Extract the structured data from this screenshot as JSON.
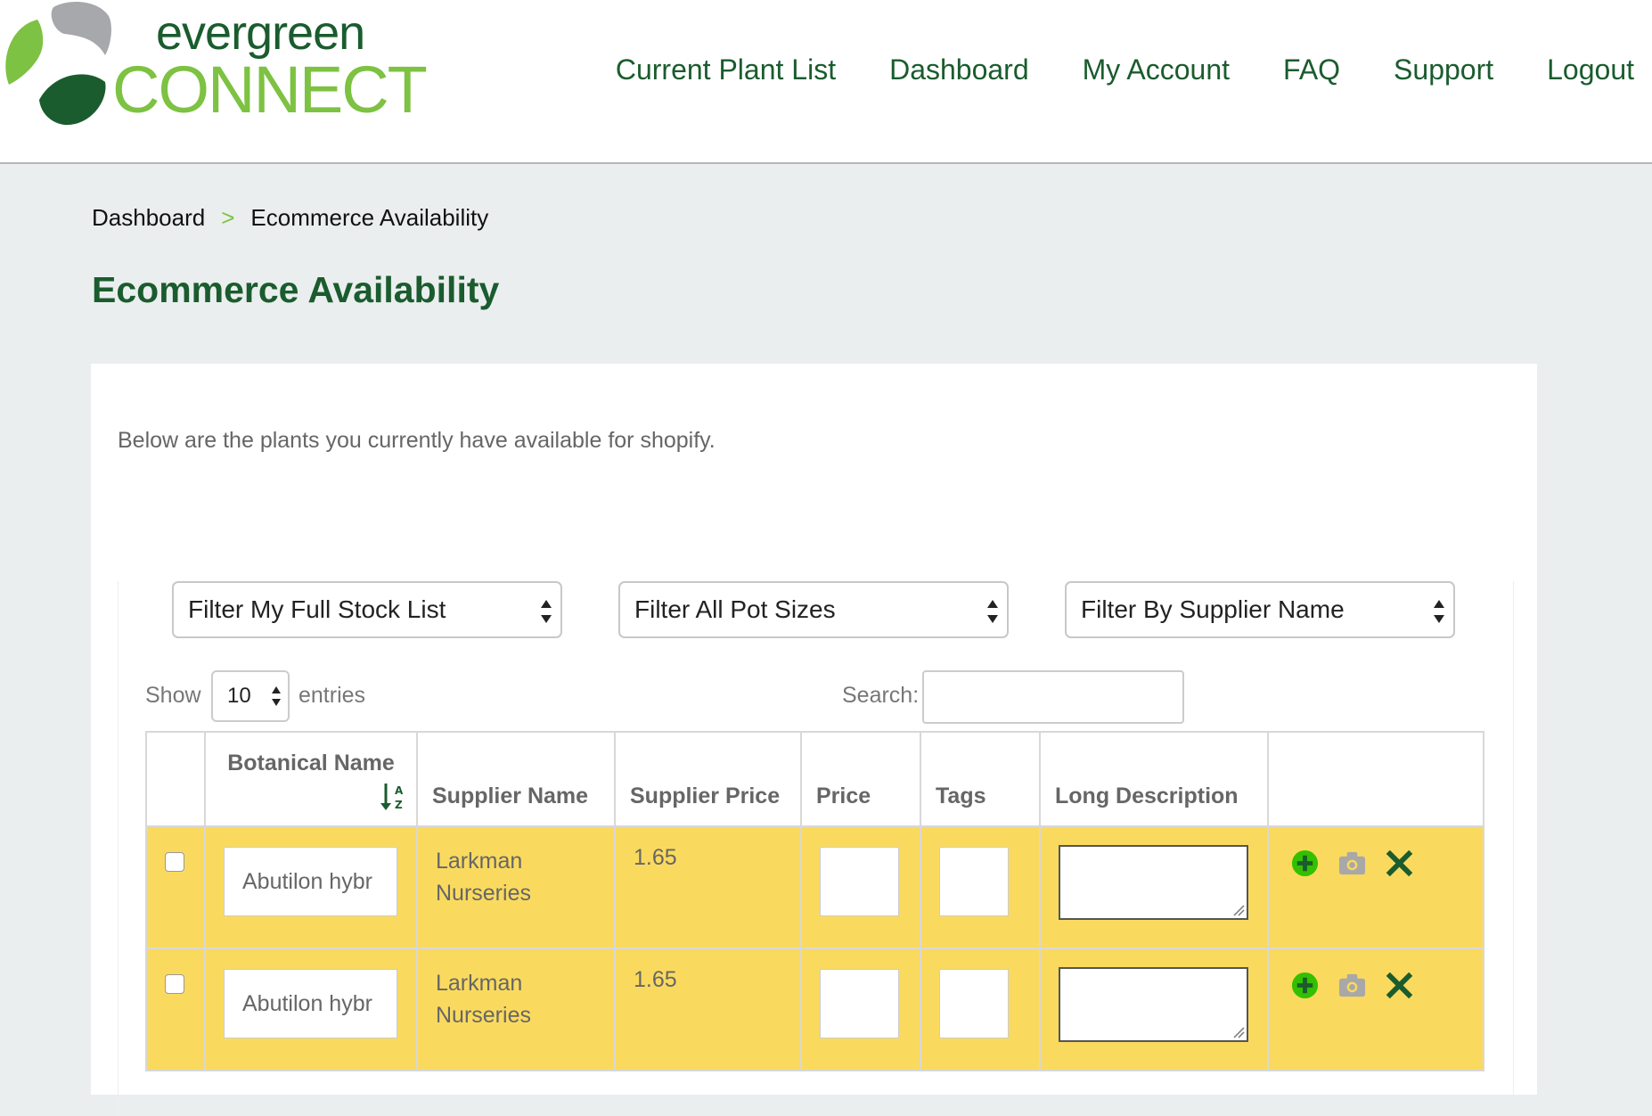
{
  "header": {
    "logo_text_top": "evergreen",
    "logo_text_bottom": "CONNECT",
    "nav": [
      "Current Plant List",
      "Dashboard",
      "My Account",
      "FAQ",
      "Support",
      "Logout"
    ]
  },
  "breadcrumb": {
    "root": "Dashboard",
    "separator": ">",
    "current": "Ecommerce Availability"
  },
  "page_title": "Ecommerce Availability",
  "intro": "Below are the plants you currently have available for shopify.",
  "filters": {
    "stock": "Filter My Full Stock List",
    "pot_sizes": "Filter All Pot Sizes",
    "supplier": "Filter By Supplier Name"
  },
  "table_controls": {
    "show_label": "Show",
    "entries_value": "10",
    "entries_label": "entries",
    "search_label": "Search:"
  },
  "columns": [
    "Botanical Name",
    "Supplier Name",
    "Supplier Price",
    "Price",
    "Tags",
    "Long Description"
  ],
  "rows": [
    {
      "botanical_name": "Abutilon hybr",
      "supplier_line1": "Larkman",
      "supplier_line2": "Nurseries",
      "supplier_price": "1.65"
    },
    {
      "botanical_name": "Abutilon hybr",
      "supplier_line1": "Larkman",
      "supplier_line2": "Nurseries",
      "supplier_price": "1.65"
    }
  ],
  "colors": {
    "brand_dark_green": "#1a5c2e",
    "brand_light_green": "#7dc242",
    "row_highlight": "#fada5e",
    "add_icon_green": "#34c000",
    "camera_icon_grey": "#a8a8a8",
    "delete_icon_green": "#1a5c2e"
  },
  "icons": [
    "add-circle-icon",
    "camera-icon",
    "delete-x-icon",
    "sort-alpha-asc-icon",
    "select-arrows-icon"
  ]
}
